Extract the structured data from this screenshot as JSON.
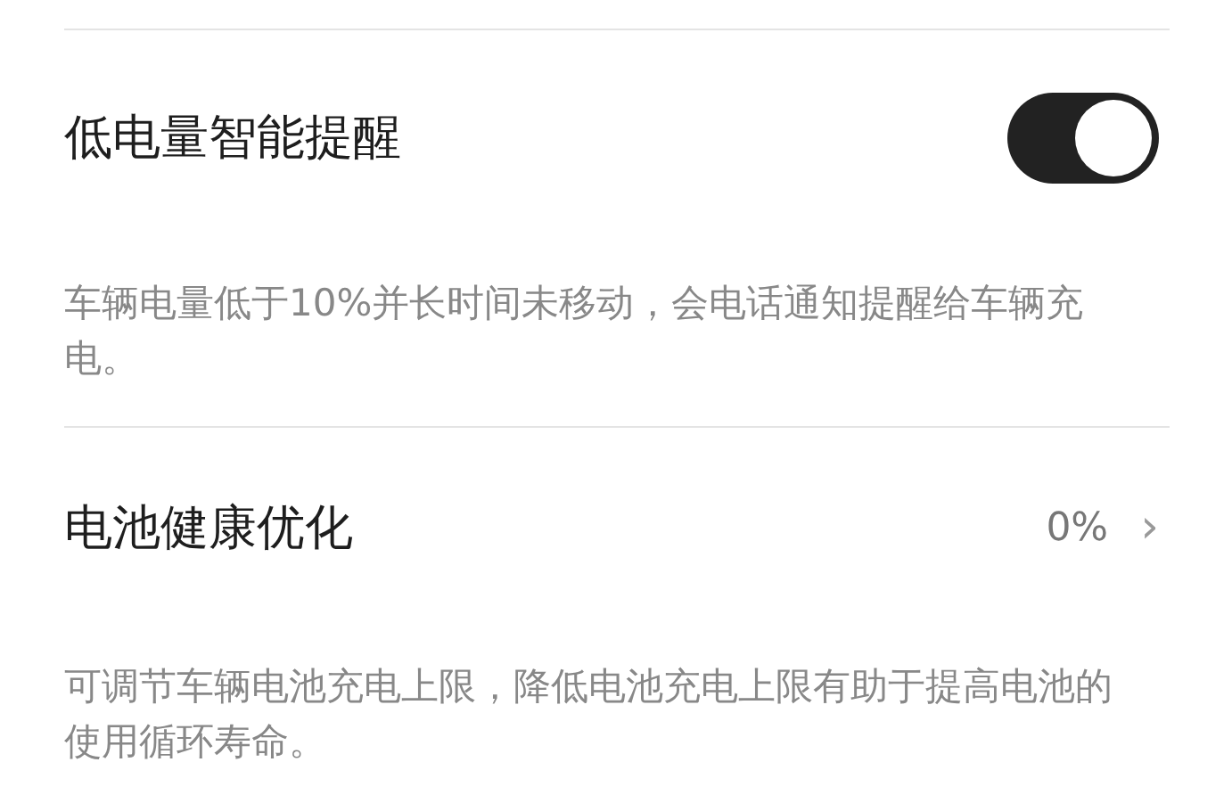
{
  "settings": [
    {
      "kind": "toggle",
      "title": "低电量智能提醒",
      "on": true,
      "description": "车辆电量低于10%并长时间未移动，会电话通知提醒给车辆充电。"
    },
    {
      "kind": "link",
      "title": "电池健康优化",
      "value": "0%",
      "chevron": "›",
      "description": "可调节车辆电池充电上限，降低电池充电上限有助于提高电池的使用循环寿命。"
    }
  ]
}
